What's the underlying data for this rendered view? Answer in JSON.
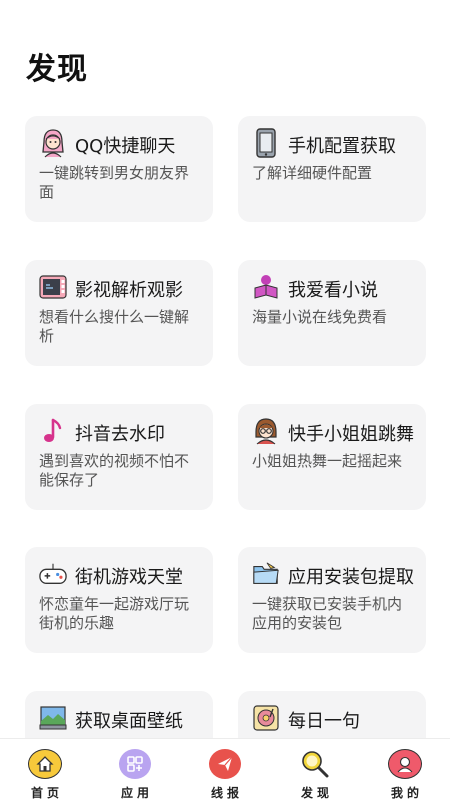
{
  "page": {
    "title": "发现"
  },
  "cards": [
    {
      "title": "QQ快捷聊天",
      "desc": "一键跳转到男女朋友界面",
      "icon": "girl-avatar-icon"
    },
    {
      "title": "手机配置获取",
      "desc": "了解详细硬件配置",
      "icon": "phone-icon"
    },
    {
      "title": "影视解析观影",
      "desc": "想看什么搜什么一键解析",
      "icon": "tv-icon"
    },
    {
      "title": "我爱看小说",
      "desc": "海量小说在线免费看",
      "icon": "reader-icon"
    },
    {
      "title": "抖音去水印",
      "desc": "遇到喜欢的视频不怕不能保存了",
      "icon": "music-note-icon"
    },
    {
      "title": "快手小姐姐跳舞",
      "desc": "小姐姐热舞一起摇起来",
      "icon": "girl-glasses-icon"
    },
    {
      "title": "街机游戏天堂",
      "desc": "怀恋童年一起游戏厅玩街机的乐趣",
      "icon": "gamepad-icon"
    },
    {
      "title": "应用安装包提取",
      "desc": "一键获取已安装手机内应用的安装包",
      "icon": "folder-icon"
    },
    {
      "title": "获取桌面壁纸",
      "desc": "",
      "icon": "wallpaper-icon"
    },
    {
      "title": "每日一句",
      "desc": "",
      "icon": "record-player-icon"
    }
  ],
  "tabbar": [
    {
      "label": "首页",
      "icon": "home-icon",
      "color": "#f7c93b"
    },
    {
      "label": "应用",
      "icon": "apps-grid-icon",
      "color": "#b9a4f0"
    },
    {
      "label": "线报",
      "icon": "paper-plane-icon",
      "color": "#e8524c"
    },
    {
      "label": "发现",
      "icon": "magnifier-icon",
      "color": "#f2d63a"
    },
    {
      "label": "我的",
      "icon": "user-icon",
      "color": "#ef5a6b"
    }
  ]
}
